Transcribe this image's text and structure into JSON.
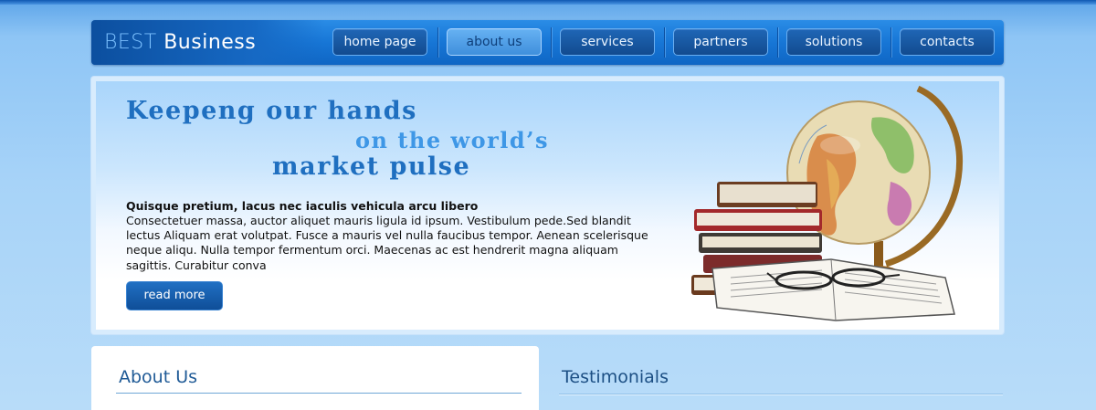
{
  "logo": {
    "word1": "BEST",
    "word2": "Business"
  },
  "nav": {
    "items": [
      {
        "label": "home page",
        "active": false
      },
      {
        "label": "about us",
        "active": true
      },
      {
        "label": "services",
        "active": false
      },
      {
        "label": "partners",
        "active": false
      },
      {
        "label": "solutions",
        "active": false
      },
      {
        "label": "contacts",
        "active": false
      }
    ]
  },
  "hero": {
    "slogan_line1": "Keepeng our hands",
    "slogan_line2": "on the world’s",
    "slogan_line3": "market pulse",
    "heading": "Quisque pretium, lacus nec iaculis vehicula arcu libero",
    "body": "Consectetuer massa, auctor aliquet mauris ligula id ipsum. Vestibulum pede.Sed blandit lectus Aliquam erat volutpat. Fusce a mauris vel nulla faucibus tempor. Aenean scelerisque neque aliqu. Nulla tempor fermentum orci.  Maecenas ac est  hendrerit magna aliquam sagittis. Curabitur conva",
    "read_more_label": "read more",
    "illustration_icon": "globe-and-books-illustration"
  },
  "sections": {
    "about_title": "About Us",
    "testimonials_title": "Testimonials"
  },
  "colors": {
    "accent": "#1776d6",
    "nav_active": "#4f9fe6",
    "slogan_dark": "#1f6fc0",
    "slogan_light": "#3e97e6",
    "title_blue": "#1f5a96"
  }
}
